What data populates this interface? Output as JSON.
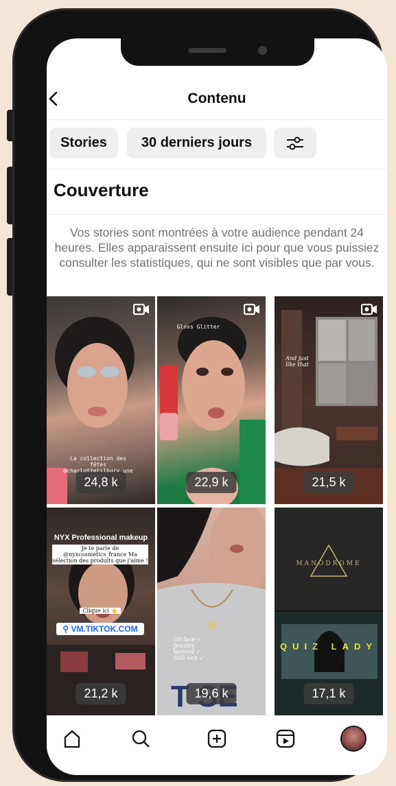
{
  "header": {
    "title": "Contenu",
    "back_icon": "chevron-left-icon"
  },
  "filters": {
    "type": "Stories",
    "period": "30 derniers jours",
    "settings_icon": "sliders-icon"
  },
  "section": {
    "title": "Couverture",
    "description": "Vos stories sont montrées à votre audience pendant 24 heures. Elles apparaissent ensuite ici pour que vous puissiez consulter les statistiques, qui ne sont visibles que par vous."
  },
  "stories": [
    {
      "reach": "24,8 k",
      "caption": "La collection des fêtes @charlottetilbury une folie",
      "icon": "video-camera-icon"
    },
    {
      "reach": "22,9 k",
      "caption": "Gloss Glitter",
      "icon": "video-camera-icon"
    },
    {
      "reach": "21,5 k",
      "caption": "And just like that",
      "icon": "video-camera-icon"
    },
    {
      "reach": "21,2 k",
      "caption": "NYX Professional makeup",
      "caption2": "Je te parle de @nyxcosmetics_france Ma sélection des produits que j'aime !",
      "caption3": "Clique ici 👆",
      "link": "VM.TIKTOK.COM"
    },
    {
      "reach": "19,6 k",
      "caption": "Oil face ✓ Jewelry layered ✓ Still sick ✓"
    },
    {
      "reach": "17,1 k",
      "caption": "MANODROME",
      "caption2": "QUIZ LADY"
    }
  ],
  "nav": {
    "items": [
      "home-icon",
      "search-icon",
      "create-icon",
      "reels-icon",
      "profile-avatar"
    ]
  },
  "colors": {
    "accent": "#111111",
    "muted": "#737373",
    "pill": "#efefef"
  }
}
